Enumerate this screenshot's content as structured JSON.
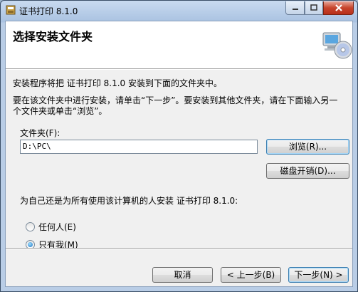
{
  "window": {
    "title": "证书打印 8.1.0",
    "minimize_icon": "minimize-icon",
    "maximize_icon": "maximize-icon",
    "close_icon": "close-icon"
  },
  "header": {
    "title": "选择安装文件夹",
    "icon": "computer-disc-icon"
  },
  "body": {
    "intro": "安装程序将把 证书打印 8.1.0 安装到下面的文件夹中。",
    "instructions_line1": "要在该文件夹中进行安装，请单击“下一步”。要安装到其他文件夹，请在下面输入另一",
    "instructions_line2": "个文件夹或单击“浏览”。"
  },
  "folder": {
    "label": "文件夹(F):",
    "value": "D:\\PC\\",
    "browse_label": "浏览(R)...",
    "disk_cost_label": "磁盘开销(D)..."
  },
  "install_for": {
    "question": "为自己还是为所有使用该计算机的人安装 证书打印 8.1.0:",
    "options": [
      {
        "label": "任何人(E)",
        "checked": false
      },
      {
        "label": "只有我(M)",
        "checked": true
      }
    ]
  },
  "footer": {
    "cancel_label": "取消",
    "back_label": "< 上一步(B)",
    "next_label": "下一步(N) >"
  }
}
